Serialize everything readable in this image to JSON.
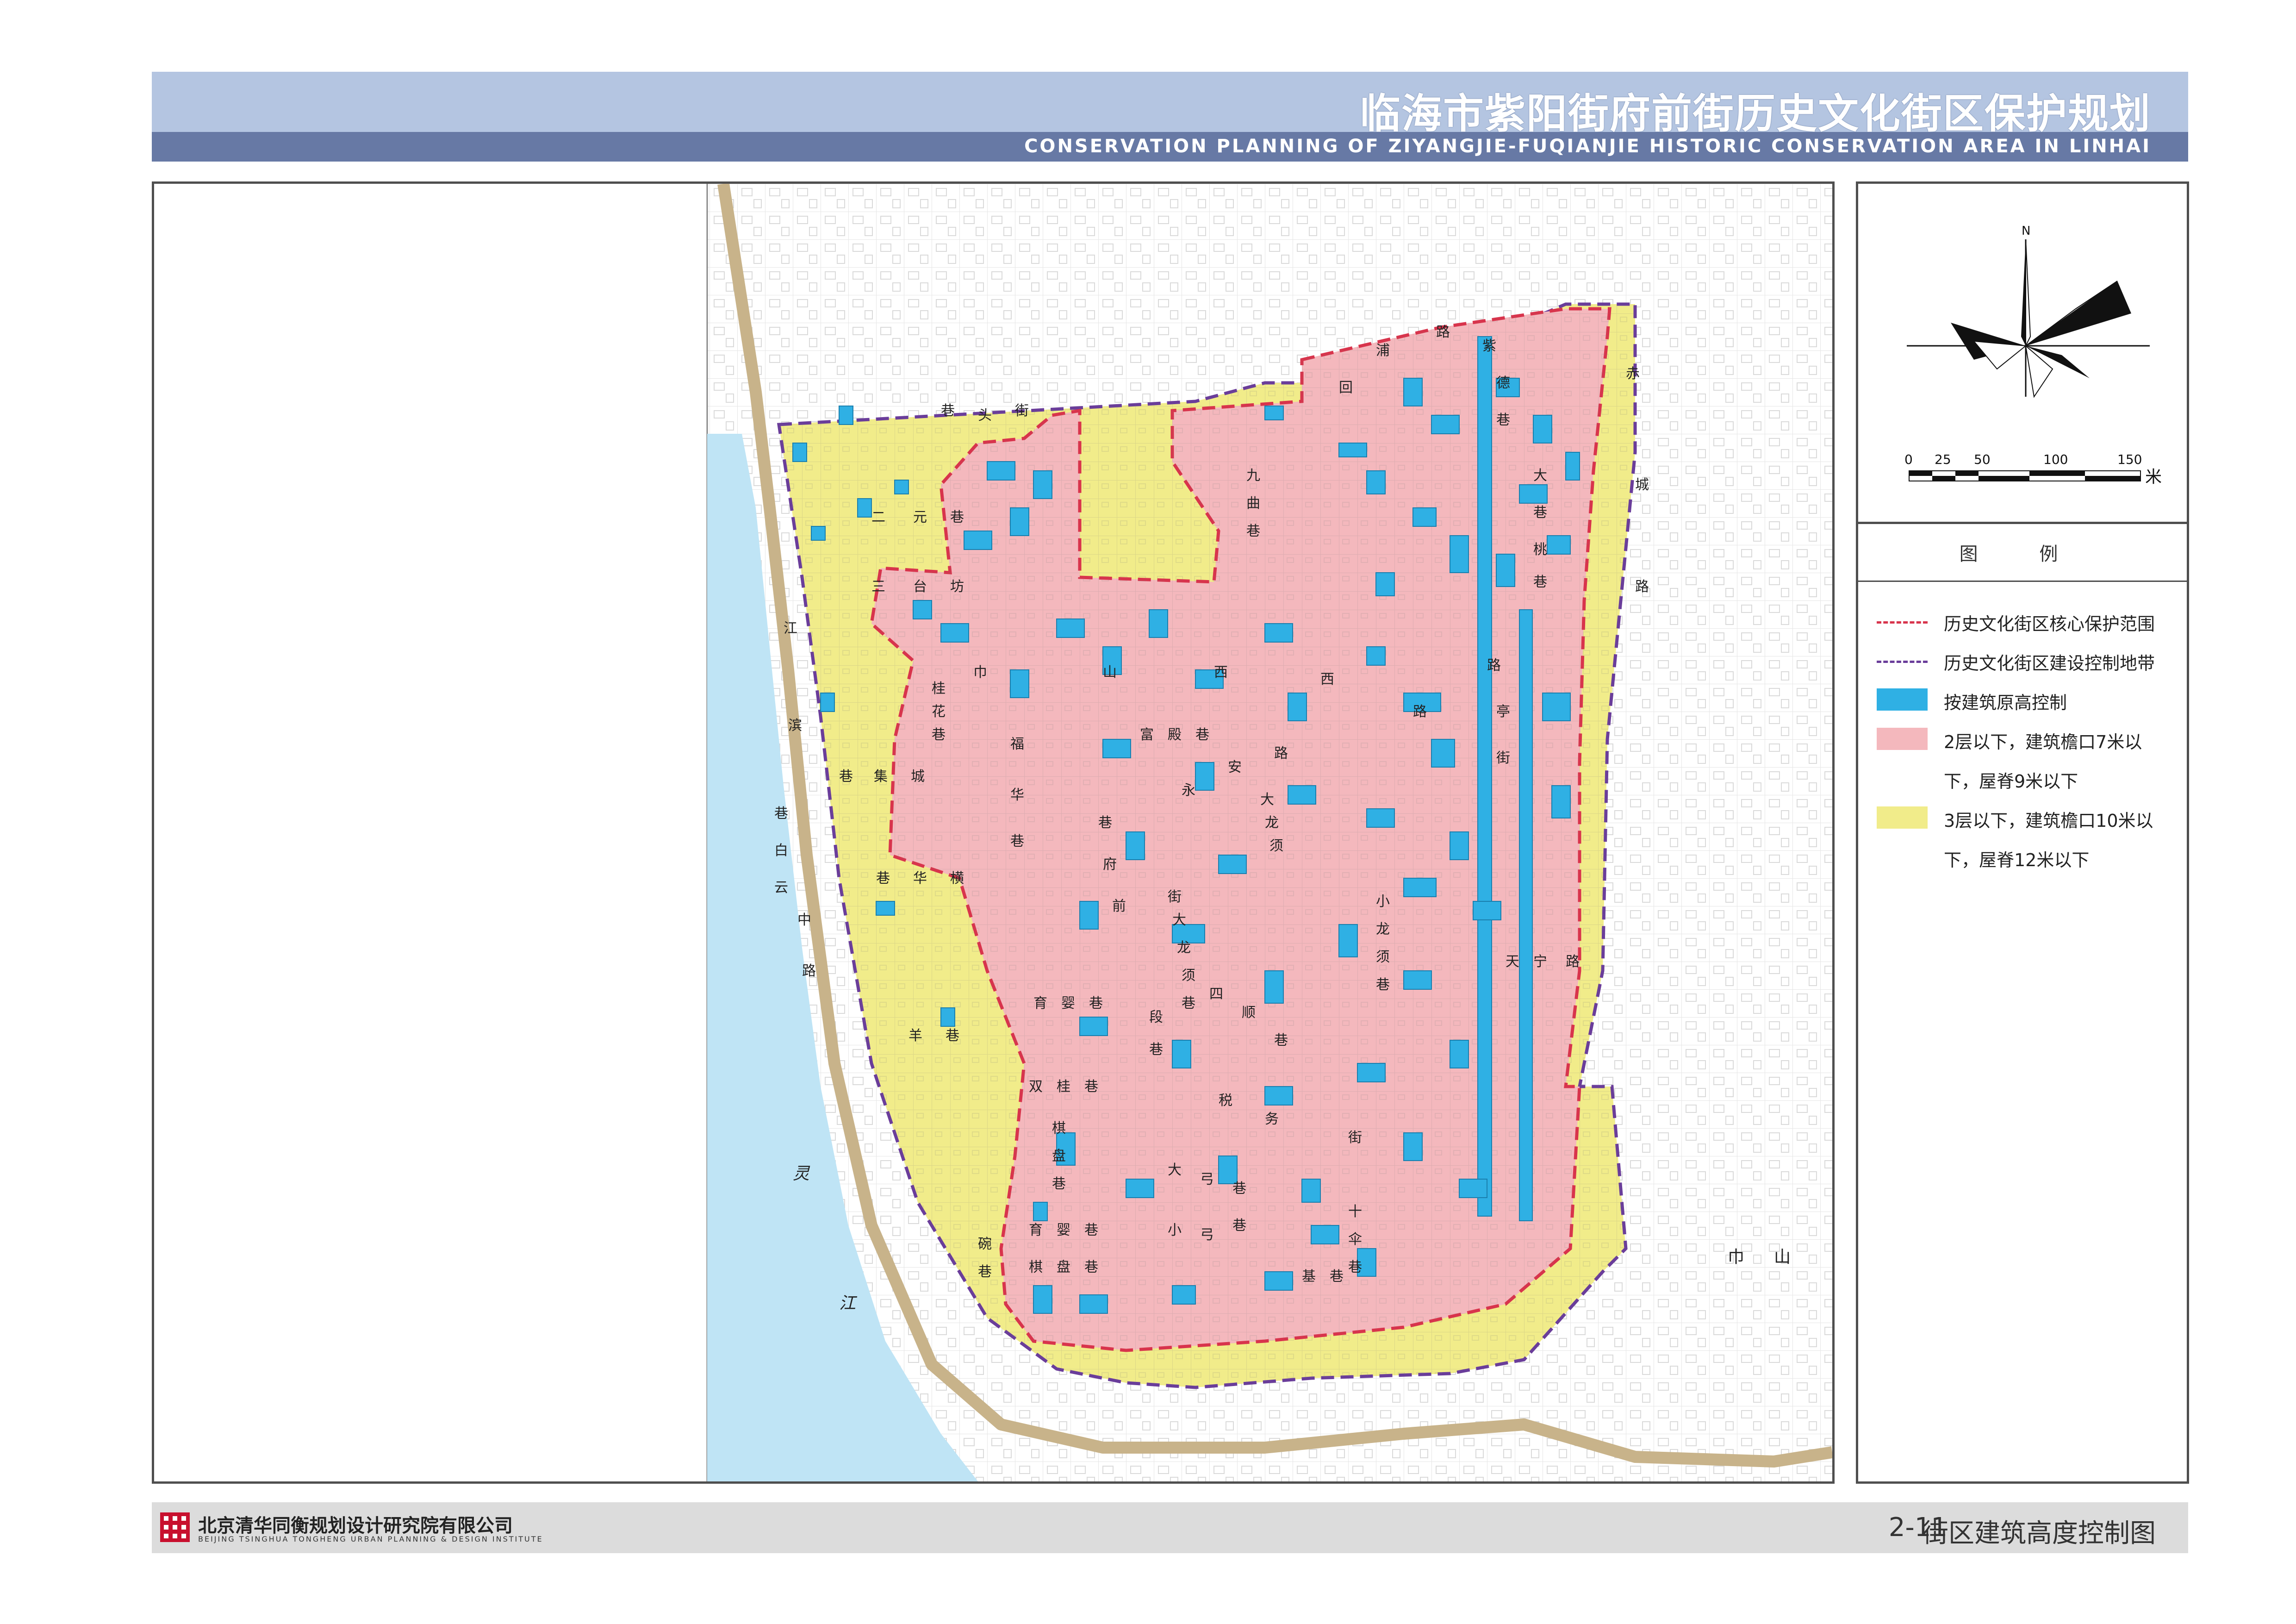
{
  "header": {
    "title": "临海市紫阳街府前街历史文化街区保护规划",
    "subtitle": "CONSERVATION PLANNING OF ZIYANGJIE-FUQIANJIE  HISTORIC CONSERVATION AREA IN LINHAI"
  },
  "map": {
    "street_labels": [
      "紫",
      "德",
      "巷",
      "大",
      "巷",
      "桃",
      "巷",
      "路",
      "西",
      "亭",
      "街",
      "巾",
      "山",
      "西",
      "路",
      "二",
      "元",
      "巷",
      "三",
      "台",
      "坊",
      "桂",
      "花",
      "巷",
      "福",
      "华",
      "巷",
      "富",
      "殿",
      "巷",
      "永",
      "安",
      "路",
      "大",
      "龙",
      "须",
      "巷",
      "集",
      "城",
      "巷",
      "白",
      "云",
      "巷",
      "华",
      "横",
      "巷",
      "府",
      "前",
      "街",
      "大",
      "龙",
      "须",
      "巷",
      "四",
      "顺",
      "巷",
      "小",
      "龙",
      "须",
      "巷",
      "天",
      "宁",
      "路",
      "育",
      "婴",
      "巷",
      "段",
      "巷",
      "双",
      "桂",
      "巷",
      "棋",
      "盘",
      "巷",
      "羊",
      "巷",
      "税",
      "务",
      "街",
      "大",
      "弓",
      "巷",
      "小",
      "弓",
      "巷",
      "十",
      "伞",
      "巷",
      "基",
      "巷",
      "江",
      "滨",
      "中",
      "路",
      "灵",
      "江",
      "巾",
      "山",
      "赤",
      "城",
      "路",
      "九",
      "曲",
      "巷",
      "回",
      "浦",
      "路",
      "街",
      "头",
      "巷",
      "育",
      "婴",
      "巷",
      "棋",
      "盘",
      "巷",
      "碗",
      "巷"
    ],
    "colors": {
      "core_protection_fill": "#f4b8bd",
      "construction_control_fill": "#f1ec8a",
      "original_height_buildings": "#2fb0e4",
      "core_boundary": "#d8344c",
      "control_boundary": "#6a3d9a",
      "river": "#bfe4f5",
      "city_wall": "#c8b38a"
    }
  },
  "compass": {
    "north_label": "N",
    "scale_ticks": [
      "0",
      "25",
      "50",
      "100",
      "150"
    ],
    "scale_unit": "米"
  },
  "legend": {
    "title": "图    例",
    "items": [
      {
        "label": "历史文化街区核心保护范围",
        "type": "dash",
        "color": "#d8344c"
      },
      {
        "label": "历史文化街区建设控制地带",
        "type": "dash",
        "color": "#6a3d9a"
      },
      {
        "label": "按建筑原高控制",
        "type": "fill",
        "color": "#2fb0e4"
      },
      {
        "label": "2层以下，建筑檐口7米以",
        "line2": "下，屋脊9米以下",
        "type": "fill",
        "color": "#f4b8bd"
      },
      {
        "label": "3层以下，建筑檐口10米以",
        "line2": "下，屋脊12米以下",
        "type": "fill",
        "color": "#f1ec8a"
      }
    ]
  },
  "footer": {
    "company": "北京清华同衡规划设计研究院有限公司",
    "company_en": "BEIJING TSINGHUA TONGHENG URBAN PLANNING & DESIGN INSTITUTE",
    "figure_number": "2-11",
    "figure_title": "街区建筑高度控制图"
  }
}
